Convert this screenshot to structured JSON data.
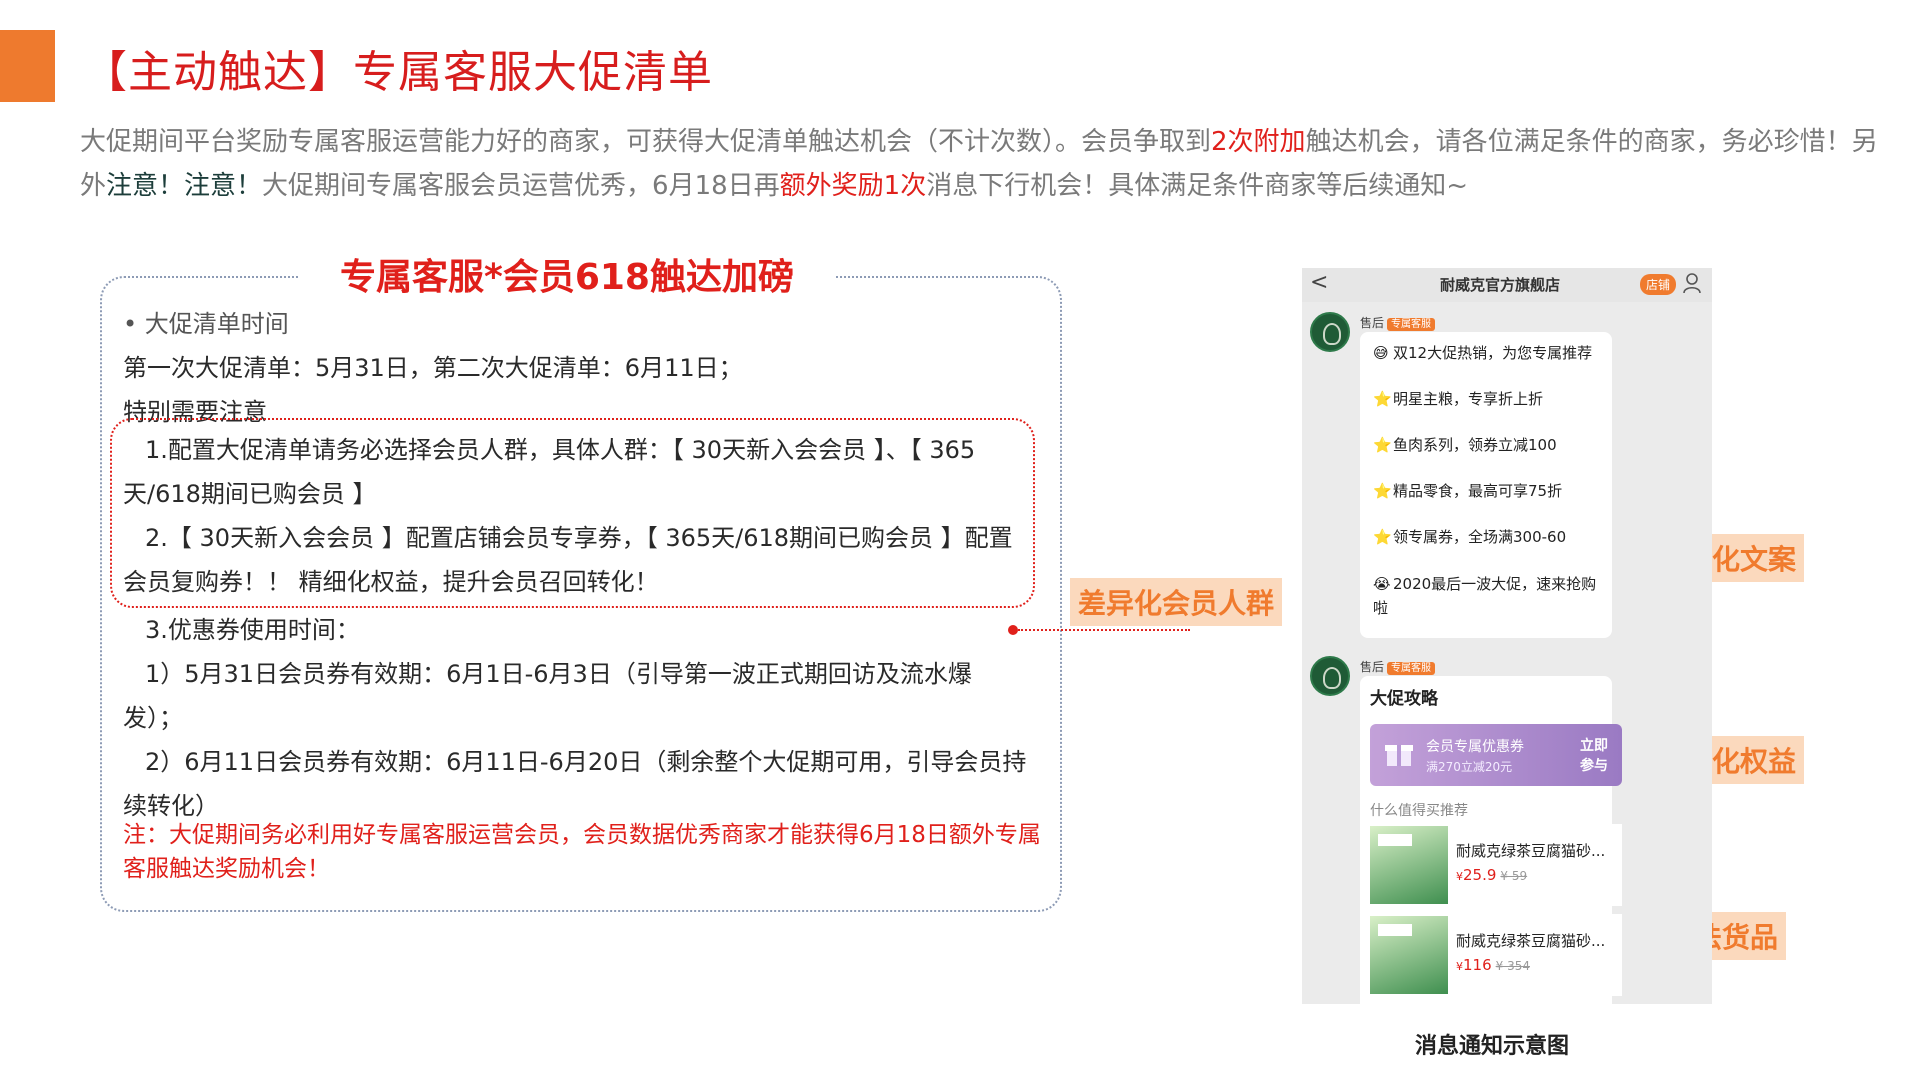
{
  "header": {
    "title": "【主动触达】专属客服大促清单"
  },
  "intro": {
    "p1": "大促期间平台奖励专属客服运营能力好的商家，可获得大促清单触达机会（不计次数）。会员争取到",
    "p1_red": "2次附加",
    "p2": "触达机会，请各位满足条件的商家，务必珍惜！另外",
    "p2_dark": "注意！注意！",
    "p3": "大促期间专属客服会员运营优秀，6月18日再",
    "p3_red": "额外奖励1次",
    "p4": "消息下行机会！具体满足条件商家等后续通知~"
  },
  "panel": {
    "title": "专属客服*会员618触达加磅",
    "bullet": "• 大促清单时间",
    "line1": "第一次大促清单：5月31日，第二次大促清单：6月11日；",
    "line2": "特别需要注意",
    "item1": "1.配置大促清单请务必选择会员人群，具体人群：【 30天新入会会员 】、【 365天/618期间已购会员 】",
    "item2": "2.【 30天新入会会员 】配置店铺会员专享券，【 365天/618期间已购会员 】配置会员复购券！！ 精细化权益，提升会员召回转化！",
    "item3": "3.优惠券使用时间：",
    "item3a_1": "1）5月31日会员券有效期：6月1日-6月3日（引导第一波正式期回访及流水爆",
    "item3a_2": "发）；",
    "item3b_1": "2）6月11日会员券有效期：6月11日-6月20日（剩余整个大促期可用，引导会员持",
    "item3b_2": "续转化）",
    "note": "注：大促期间务必利用好专属客服运营会员，会员数据优秀商家才能获得6月18日额外专属客服触达奖励机会！"
  },
  "tags": {
    "crowd": "差异化会员人群",
    "copy": "差异化文案",
    "benefit": "差异化权益",
    "goods": "算法货品"
  },
  "phone": {
    "back": "<",
    "store_name": "耐威克官方旗舰店",
    "shop_badge": "店铺",
    "seller_label": "售后",
    "seller_badge": "专属客服",
    "msg1": [
      {
        "icon": "😅",
        "text": "双12大促热销，为您专属推荐"
      },
      {
        "icon": "⭐",
        "text": "明星主粮，专享折上折"
      },
      {
        "icon": "⭐",
        "text": "鱼肉系列，领券立减100"
      },
      {
        "icon": "⭐",
        "text": "精品零食，最高可享75折"
      },
      {
        "icon": "⭐",
        "text": "领专属券，全场满300-60"
      },
      {
        "icon": "😭",
        "text": "2020最后一波大促，速来抢购啦"
      }
    ],
    "strategy_title": "大促攻略",
    "coupon_name": "会员专属优惠券",
    "coupon_rule": "满270立减20元",
    "coupon_btn": "立即参与",
    "rec_title": "什么值得买推荐",
    "products": [
      {
        "name": "耐威克绿茶豆腐猫砂...",
        "currency": "¥",
        "price": "25.9",
        "orig": "¥ 59"
      },
      {
        "name": "耐威克绿茶豆腐猫砂...",
        "currency": "¥",
        "price": "116",
        "orig": "¥ 354"
      }
    ]
  },
  "caption": "消息通知示意图",
  "colors": {
    "accent_orange": "#ee7a2e",
    "title_red": "#d71d1d",
    "tag_bg": "#fbd9bd",
    "tag_text": "#f07b2e"
  }
}
